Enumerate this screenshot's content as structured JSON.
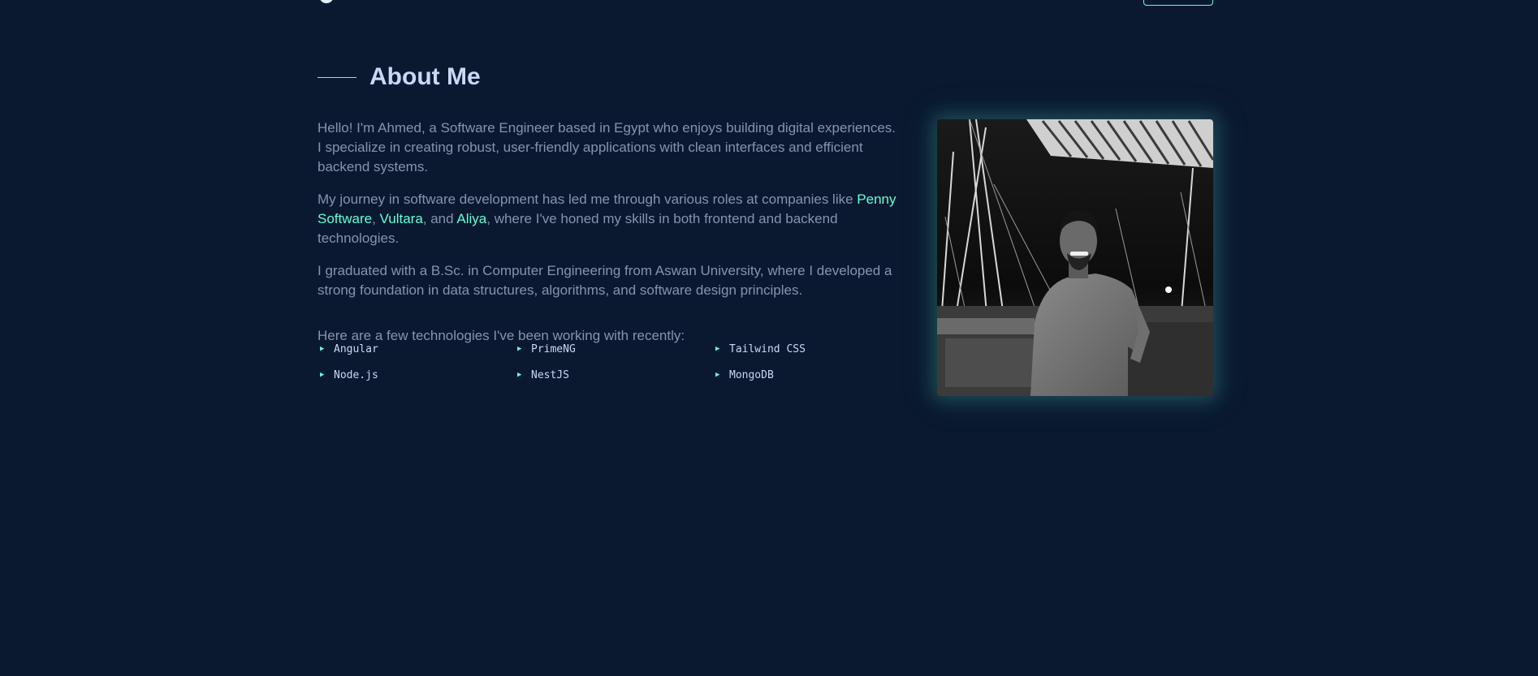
{
  "section": {
    "title": "About Me"
  },
  "about": {
    "p1": "Hello! I'm Ahmed, a Software Engineer based in Egypt who enjoys building digital experiences. I specialize in creating robust, user-friendly applications with clean interfaces and efficient backend systems.",
    "p2_before": "My journey in software development has led me through various roles at companies like ",
    "company_1": "Penny Software",
    "sep_1": ", ",
    "company_2": "Vultara",
    "sep_2": ", and ",
    "company_3": "Aliya",
    "p2_after": ", where I've honed my skills in both frontend and backend technologies.",
    "p3": "I graduated with a B.Sc. in Computer Engineering from Aswan University, where I developed a strong foundation in data structures, algorithms, and software design principles.",
    "tech_intro": "Here are a few technologies I've been working with recently:"
  },
  "technologies": [
    "Angular",
    "PrimeNG",
    "Tailwind CSS",
    "Node.js",
    "NestJS",
    "MongoDB"
  ],
  "icons": {
    "bullet": "triangle-right-icon"
  },
  "colors": {
    "background": "#0a192f",
    "accent": "#64ffda",
    "heading": "#ccd6f6",
    "body_text": "#8892b0"
  }
}
